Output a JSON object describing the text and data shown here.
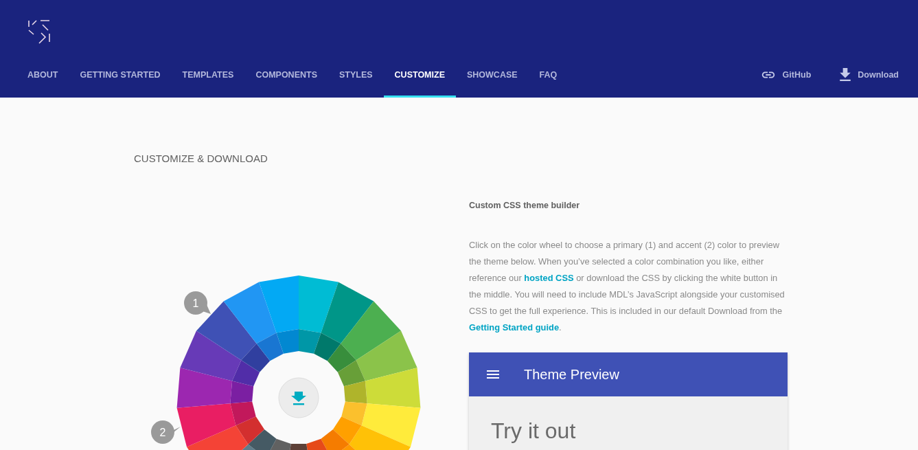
{
  "header": {
    "nav": [
      {
        "label": "ABOUT",
        "selected": false
      },
      {
        "label": "GETTING STARTED",
        "selected": false
      },
      {
        "label": "TEMPLATES",
        "selected": false
      },
      {
        "label": "COMPONENTS",
        "selected": false
      },
      {
        "label": "STYLES",
        "selected": false
      },
      {
        "label": "CUSTOMIZE",
        "selected": true
      },
      {
        "label": "SHOWCASE",
        "selected": false
      },
      {
        "label": "FAQ",
        "selected": false
      }
    ],
    "links": [
      {
        "kind": "github",
        "label": "GitHub"
      },
      {
        "kind": "download",
        "label": "Download"
      }
    ]
  },
  "page_title": "CUSTOMIZE & DOWNLOAD",
  "color_wheel": {
    "markers": [
      {
        "label": "1"
      },
      {
        "label": "2"
      }
    ]
  },
  "builder": {
    "heading": "Custom CSS theme builder",
    "paragraph": [
      {
        "kind": "text",
        "text": "Click on the color wheel to choose a primary (1) and accent (2) color to preview the theme below. When you’ve selected a color combination you like, either reference our "
      },
      {
        "kind": "link",
        "text": "hosted CSS"
      },
      {
        "kind": "text",
        "text": " or download the CSS by clicking the white button in the middle. You will need to include MDL’s JavaScript alongside your customised CSS to get the full experience. This is included in our default Download from the "
      },
      {
        "kind": "link",
        "text": "Getting Started guide"
      },
      {
        "kind": "text",
        "text": "."
      }
    ],
    "preview": {
      "title": "Theme Preview",
      "body_title": "Try it out"
    }
  }
}
